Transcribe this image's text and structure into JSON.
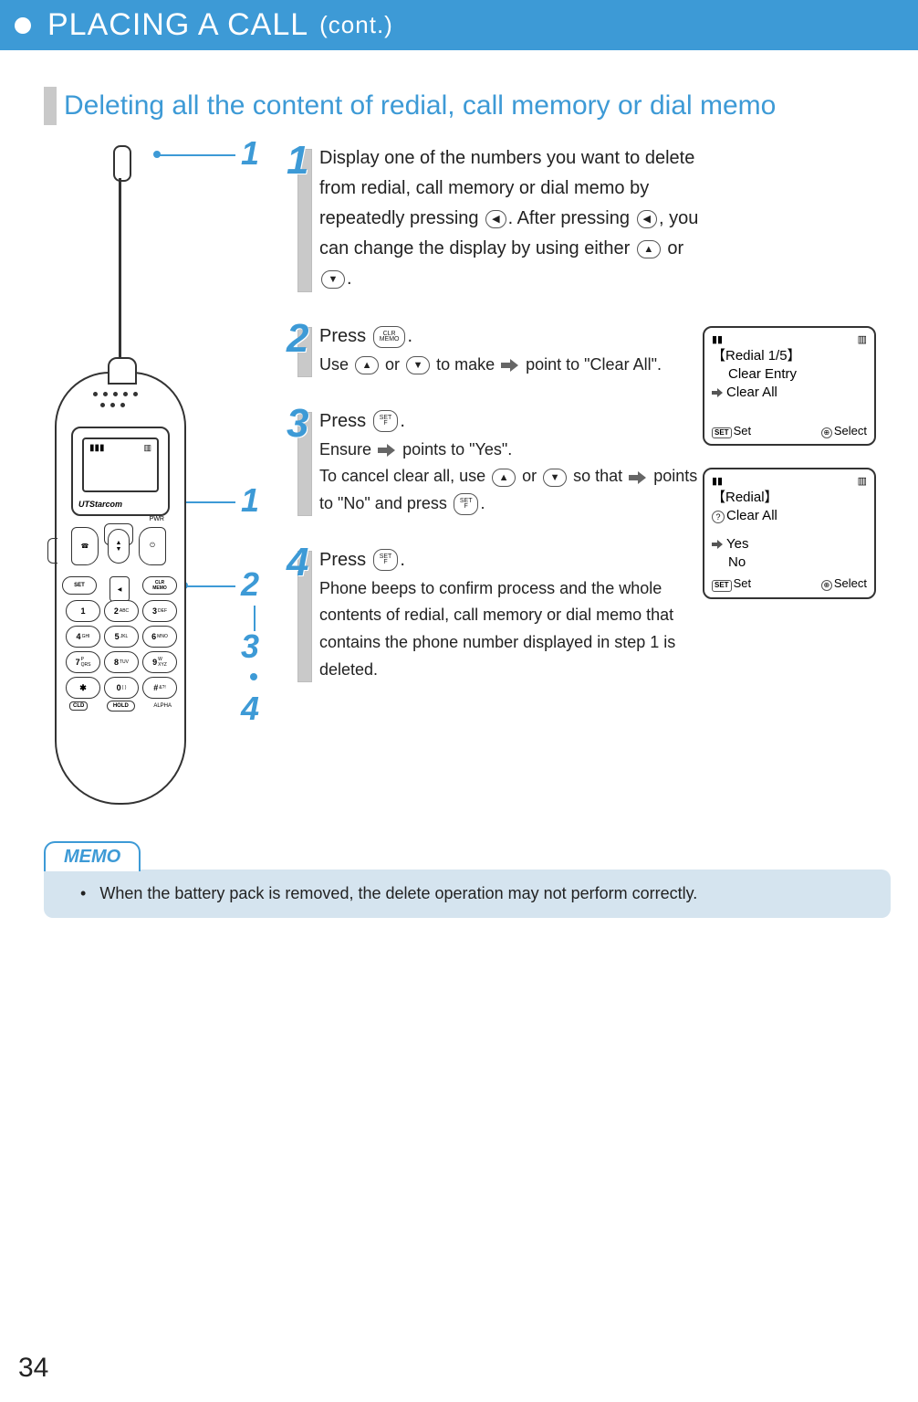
{
  "header": {
    "title": "PLACING A CALL",
    "cont": "(cont.)"
  },
  "section_heading": "Deleting all the content of redial, call memory or dial memo",
  "phone": {
    "brand": "UTStarcom",
    "uts_label": "UTS",
    "pwr_label": "PWR",
    "set_label": "SET",
    "clr_label": "CLR MEMO",
    "hold_label": "HOLD",
    "alpha_label": "ALPHA",
    "cld_label": "CLD",
    "keys": [
      {
        "main": "1",
        "sub": ""
      },
      {
        "main": "2",
        "sub": "ABC"
      },
      {
        "main": "3",
        "sub": "DEF"
      },
      {
        "main": "4",
        "sub": "GHI"
      },
      {
        "main": "5",
        "sub": "JKL"
      },
      {
        "main": "6",
        "sub": "MNO"
      },
      {
        "main": "7",
        "sub": "PQRS"
      },
      {
        "main": "8",
        "sub": "TUV"
      },
      {
        "main": "9",
        "sub": "WXYZ"
      },
      {
        "main": "✱",
        "sub": ""
      },
      {
        "main": "0",
        "sub": "( )"
      },
      {
        "main": "#",
        "sub": "&?!"
      }
    ],
    "callout_numbers": [
      "1",
      "1",
      "2",
      "3",
      "4"
    ]
  },
  "steps": [
    {
      "num": "1",
      "line1": "Display one of the numbers you want to delete from redial, call memory or dial memo by repeatedly pressing ",
      "line2": ". After pressing ",
      "line3": ", you can change the display by using either ",
      "line4": " or ",
      "line5": "."
    },
    {
      "num": "2",
      "lead": "Press ",
      "lead_key": "CLR MEMO",
      "sub1": "Use ",
      "sub_or": " or ",
      "sub2": " to make ",
      "sub3": " point to \"Clear All\"."
    },
    {
      "num": "3",
      "lead": "Press ",
      "lead_key": "SET F",
      "sub1": "Ensure ",
      "sub2": " points to \"Yes\".",
      "sub3": "To cancel clear all, use ",
      "sub_or": " or ",
      "sub4": " so that ",
      "sub5": " points to \"No\" and press ",
      "sub6": "."
    },
    {
      "num": "4",
      "lead": "Press ",
      "lead_key": "SET F",
      "sub": "Phone beeps to confirm process and the whole contents of redial, call memory or dial memo that contains the phone number displayed in step 1 is deleted."
    }
  ],
  "screens": {
    "a": {
      "title": "【Redial 1/5】",
      "opt1": "Clear Entry",
      "opt2": "Clear All",
      "set": "Set",
      "select": "Select"
    },
    "b": {
      "title": "【Redial】",
      "q": "Clear All",
      "opt1": "Yes",
      "opt2": "No",
      "set": "Set",
      "select": "Select"
    }
  },
  "memo": {
    "label": "MEMO",
    "text": "When the battery pack is removed, the delete operation may not perform correctly."
  },
  "page_number": "34",
  "icons": {
    "redial_key": "◀",
    "up": "▲",
    "down": "▼",
    "set_over": "SET",
    "set_under": "F",
    "clr_over": "CLR",
    "clr_under": "MEMO"
  }
}
